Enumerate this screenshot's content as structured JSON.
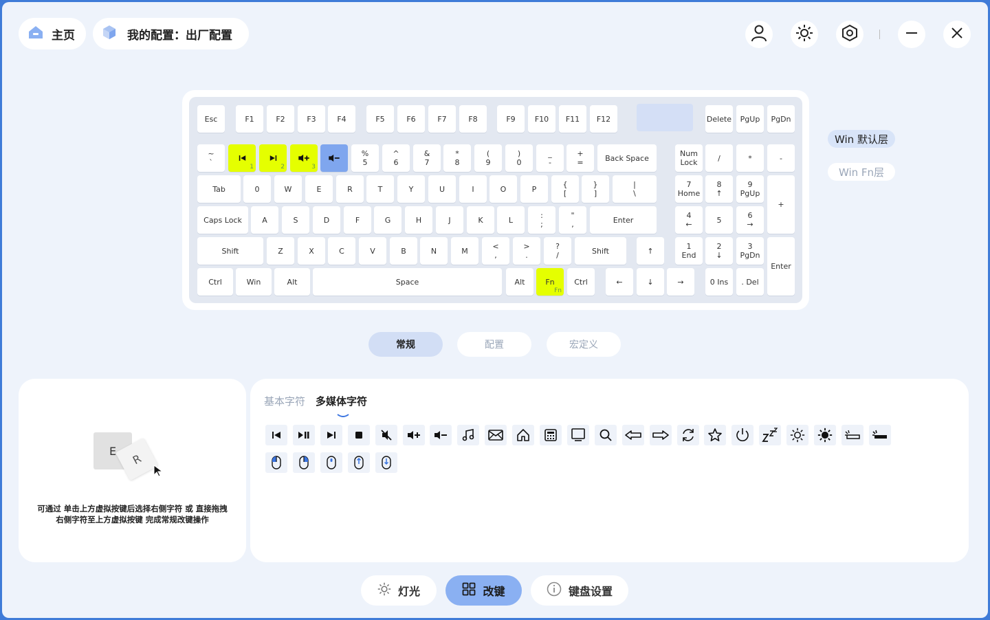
{
  "header": {
    "home_label": "主页",
    "config_label": "我的配置：出厂配置"
  },
  "keyboard": {
    "rows": [
      [
        {
          "id": "esc",
          "l1": "Esc"
        },
        {
          "id": "f1",
          "l1": "F1"
        },
        {
          "id": "f2",
          "l1": "F2"
        },
        {
          "id": "f3",
          "l1": "F3"
        },
        {
          "id": "f4",
          "l1": "F4"
        },
        {
          "id": "f5",
          "l1": "F5"
        },
        {
          "id": "f6",
          "l1": "F6"
        },
        {
          "id": "f7",
          "l1": "F7"
        },
        {
          "id": "f8",
          "l1": "F8"
        },
        {
          "id": "f9",
          "l1": "F9"
        },
        {
          "id": "f10",
          "l1": "F10"
        },
        {
          "id": "f11",
          "l1": "F11"
        },
        {
          "id": "f12",
          "l1": "F12"
        },
        {
          "id": "blank",
          "l1": ""
        },
        {
          "id": "delete",
          "l1": "Delete"
        },
        {
          "id": "pgup",
          "l1": "PgUp"
        },
        {
          "id": "pgdn",
          "l1": "PgDn"
        }
      ],
      [
        {
          "id": "backtick",
          "l1": "~",
          "l2": "`"
        },
        {
          "id": "k1",
          "icon": "prev-track-icon",
          "sub": "1"
        },
        {
          "id": "k2",
          "icon": "next-track-icon",
          "sub": "2"
        },
        {
          "id": "k3",
          "icon": "volume-up-icon",
          "sub": "3"
        },
        {
          "id": "k4",
          "icon": "volume-down-icon"
        },
        {
          "id": "k5",
          "l1": "%",
          "l2": "5"
        },
        {
          "id": "k6",
          "l1": "^",
          "l2": "6"
        },
        {
          "id": "k7",
          "l1": "&",
          "l2": "7"
        },
        {
          "id": "k8",
          "l1": "*",
          "l2": "8"
        },
        {
          "id": "k9",
          "l1": "(",
          "l2": "9"
        },
        {
          "id": "k0",
          "l1": ")",
          "l2": "0"
        },
        {
          "id": "minus",
          "l1": "_",
          "l2": "-"
        },
        {
          "id": "equal",
          "l1": "+",
          "l2": "="
        },
        {
          "id": "backspace",
          "l1": "Back Space"
        },
        {
          "id": "numlock",
          "l1": "Num",
          "l2": "Lock"
        },
        {
          "id": "numdiv",
          "l1": "/"
        },
        {
          "id": "nummul",
          "l1": "*"
        },
        {
          "id": "numsub",
          "l1": "-"
        }
      ],
      [
        {
          "id": "tab",
          "l1": "Tab"
        },
        {
          "id": "q",
          "l1": "0"
        },
        {
          "id": "w",
          "l1": "W"
        },
        {
          "id": "e",
          "l1": "E"
        },
        {
          "id": "r",
          "l1": "R"
        },
        {
          "id": "t",
          "l1": "T"
        },
        {
          "id": "y",
          "l1": "Y"
        },
        {
          "id": "u",
          "l1": "U"
        },
        {
          "id": "i",
          "l1": "I"
        },
        {
          "id": "o",
          "l1": "O"
        },
        {
          "id": "p",
          "l1": "P"
        },
        {
          "id": "lbracket",
          "l1": "{",
          "l2": "["
        },
        {
          "id": "rbracket",
          "l1": "}",
          "l2": "]"
        },
        {
          "id": "backslash",
          "l1": "|",
          "l2": "\\"
        },
        {
          "id": "num7",
          "l1": "7",
          "l2": "Home"
        },
        {
          "id": "num8",
          "l1": "8",
          "l2": "↑"
        },
        {
          "id": "num9",
          "l1": "9",
          "l2": "PgUp"
        },
        {
          "id": "numadd",
          "l1": "+"
        }
      ],
      [
        {
          "id": "capslock",
          "l1": "Caps Lock"
        },
        {
          "id": "a",
          "l1": "A"
        },
        {
          "id": "s",
          "l1": "S"
        },
        {
          "id": "d",
          "l1": "D"
        },
        {
          "id": "f",
          "l1": "F"
        },
        {
          "id": "g",
          "l1": "G"
        },
        {
          "id": "h",
          "l1": "H"
        },
        {
          "id": "j",
          "l1": "J"
        },
        {
          "id": "k",
          "l1": "K"
        },
        {
          "id": "l",
          "l1": "L"
        },
        {
          "id": "semicolon",
          "l1": ":",
          "l2": ";"
        },
        {
          "id": "quote",
          "l1": "\"",
          "l2": ","
        },
        {
          "id": "enter",
          "l1": "Enter"
        },
        {
          "id": "num4",
          "l1": "4",
          "l2": "←"
        },
        {
          "id": "num5",
          "l1": "5"
        },
        {
          "id": "num6",
          "l1": "6",
          "l2": "→"
        }
      ],
      [
        {
          "id": "lshift",
          "l1": "Shift"
        },
        {
          "id": "z",
          "l1": "Z"
        },
        {
          "id": "x",
          "l1": "X"
        },
        {
          "id": "c",
          "l1": "C"
        },
        {
          "id": "v",
          "l1": "V"
        },
        {
          "id": "b",
          "l1": "B"
        },
        {
          "id": "n",
          "l1": "N"
        },
        {
          "id": "m",
          "l1": "M"
        },
        {
          "id": "comma",
          "l1": "<",
          "l2": ","
        },
        {
          "id": "period",
          "l1": ">",
          "l2": "."
        },
        {
          "id": "slash",
          "l1": "?",
          "l2": "/"
        },
        {
          "id": "rshift",
          "l1": "Shift"
        },
        {
          "id": "up",
          "l1": "↑"
        },
        {
          "id": "num1",
          "l1": "1",
          "l2": "End"
        },
        {
          "id": "num2",
          "l1": "2",
          "l2": "↓"
        },
        {
          "id": "num3",
          "l1": "3",
          "l2": "PgDn"
        },
        {
          "id": "numenter",
          "l1": "Enter"
        }
      ],
      [
        {
          "id": "lctrl",
          "l1": "Ctrl"
        },
        {
          "id": "lwin",
          "l1": "Win"
        },
        {
          "id": "lalt",
          "l1": "Alt"
        },
        {
          "id": "space",
          "l1": "Space"
        },
        {
          "id": "ralt",
          "l1": "Alt"
        },
        {
          "id": "fn",
          "l1": "Fn",
          "sub": "Fn"
        },
        {
          "id": "rctrl",
          "l1": "Ctrl"
        },
        {
          "id": "left",
          "l1": "←"
        },
        {
          "id": "down",
          "l1": "↓"
        },
        {
          "id": "right",
          "l1": "→"
        },
        {
          "id": "num0",
          "l1": "0 Ins"
        },
        {
          "id": "numdel",
          "l1": ". Del"
        }
      ]
    ]
  },
  "layers": {
    "active": "Win 默认层",
    "inactive": "Win Fn层"
  },
  "tabs": [
    {
      "label": "常规",
      "active": true
    },
    {
      "label": "配置",
      "active": false
    },
    {
      "label": "宏定义",
      "active": false
    }
  ],
  "hint": {
    "key1": "E",
    "key2": "R",
    "line1": "可通过 单击上方虚拟按键后选择右侧字符 或 直接拖拽",
    "line2": "右侧字符至上方虚拟按键 完成常规改键操作"
  },
  "charset_tabs": {
    "basic": "基本字符",
    "media": "多媒体字符"
  },
  "media_icons_row1": [
    "prev-track-icon",
    "play-pause-icon",
    "next-track-icon",
    "stop-icon",
    "mute-icon",
    "volume-up-icon",
    "volume-down-icon",
    "music-icon",
    "mail-icon",
    "home-icon",
    "calculator-icon",
    "my-computer-icon",
    "search-icon",
    "browser-back-icon",
    "browser-forward-icon",
    "refresh-icon",
    "favorites-icon",
    "power-icon",
    "sleep-icon",
    "brightness-down-icon",
    "brightness-up-icon",
    "backlight-down-icon",
    "backlight-up-icon"
  ],
  "media_icons_row2": [
    "mouse-left-click-icon",
    "mouse-right-click-icon",
    "mouse-middle-click-icon",
    "mouse-scroll-up-icon",
    "mouse-scroll-down-icon"
  ],
  "bottom_nav": {
    "light_label": "灯光",
    "remap_label": "改键",
    "settings_label": "键盘设置"
  },
  "colors": {
    "accent": "#7fa6ee",
    "highlight": "#e5ff00",
    "background": "#eef3fb"
  }
}
